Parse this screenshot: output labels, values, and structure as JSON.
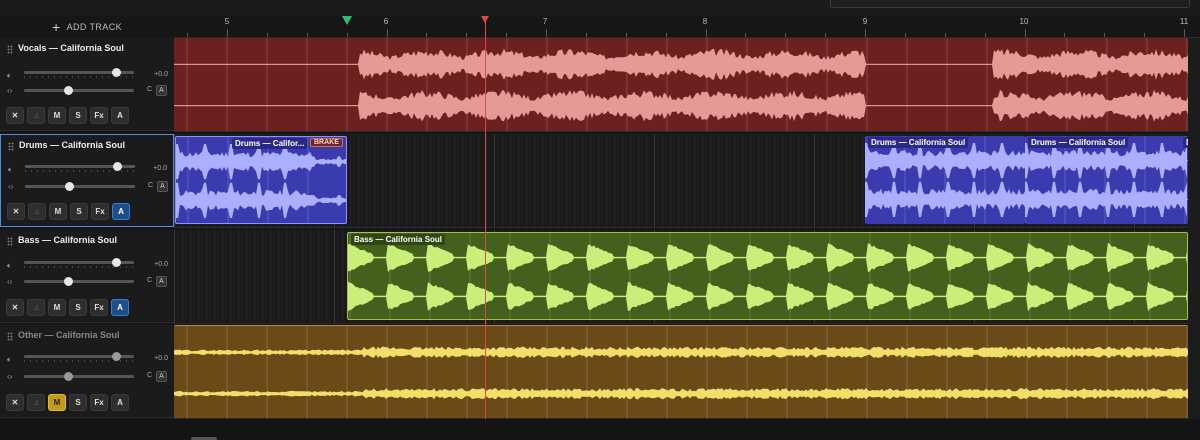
{
  "header": {
    "add_track_label": "ADD TRACK"
  },
  "ruler": {
    "bars": [
      "5",
      "6",
      "7",
      "8",
      "9",
      "10",
      "11"
    ]
  },
  "tracks": [
    {
      "name": "Vocals — California Soul",
      "volume": 0.86,
      "pan": 0.4,
      "volume_label": "+0.0",
      "pan_label": "C",
      "buttons": [
        "✕",
        "♫",
        "M",
        "S",
        "Fx",
        "A"
      ],
      "active": {
        "M": false,
        "A": false
      },
      "color": "#6e2020",
      "wave_color": "#e69a96",
      "clips": []
    },
    {
      "name": "Drums — California Soul",
      "volume": 0.86,
      "pan": 0.4,
      "volume_label": "+0.0",
      "pan_label": "C",
      "buttons": [
        "✕",
        "♫",
        "M",
        "S",
        "Fx",
        "A"
      ],
      "active": {
        "M": false,
        "A": true
      },
      "color": "#3b3bb0",
      "wave_color": "#aab0ff",
      "clips": [
        "Drums — Califor...",
        "Drums — California Soul",
        "Drums — California Soul",
        "D"
      ],
      "badge": "BRAKE"
    },
    {
      "name": "Bass — California Soul",
      "volume": 0.86,
      "pan": 0.4,
      "volume_label": "+0.0",
      "pan_label": "C",
      "buttons": [
        "✕",
        "♫",
        "M",
        "S",
        "Fx",
        "A"
      ],
      "active": {
        "M": false,
        "A": true
      },
      "color": "#44601c",
      "wave_color": "#c9ef7a",
      "clips": [
        "Bass — California Soul"
      ]
    },
    {
      "name": "Other — California Soul",
      "volume": 0.86,
      "pan": 0.4,
      "volume_label": "+0.0",
      "pan_label": "C",
      "buttons": [
        "✕",
        "♫",
        "M",
        "S",
        "Fx",
        "A"
      ],
      "active": {
        "M": true,
        "A": false
      },
      "color": "#6b4a18",
      "wave_color": "#f0e06a",
      "clips": []
    }
  ],
  "colors": {
    "accent": "#4a90e2",
    "playhead": "#d94b4b",
    "loop": "#2fbf71"
  }
}
